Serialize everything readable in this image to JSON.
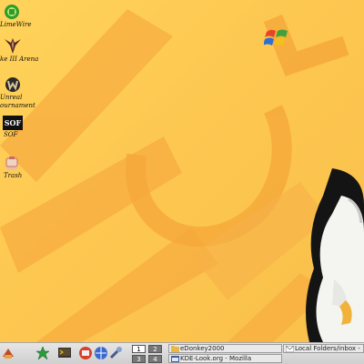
{
  "desktop": {
    "icons": [
      {
        "label": "LimeWire",
        "icon": "limewire-icon"
      },
      {
        "label": "ke III Arena",
        "icon": "quake-icon"
      },
      {
        "label_lines": [
          "Unreal",
          "ournament"
        ],
        "icon": "unreal-icon"
      },
      {
        "label": "SOF",
        "icon": "sof-icon"
      },
      {
        "label": "Trash",
        "icon": "trash-icon"
      }
    ]
  },
  "taskbar": {
    "launchers": [
      "kmail-icon",
      "star-icon",
      "shell-icon",
      "terminal-icon",
      "network-icon",
      "wrench-icon"
    ],
    "pager": {
      "desktops": [
        "1",
        "2",
        "3",
        "4"
      ],
      "active": "1"
    },
    "tasks": [
      {
        "label": "eDonkey2000",
        "icon": "folder-icon"
      },
      {
        "label": "Local Folders/inbox -",
        "icon": "mail-icon"
      },
      {
        "label": "KDE-Look.org - Mozilla",
        "icon": "mozilla-icon"
      }
    ]
  },
  "colors": {
    "wallpaper": "#fdc750",
    "wallpaper_shapes": "#f7aa3c",
    "taskbar": "#d9d9d9"
  }
}
